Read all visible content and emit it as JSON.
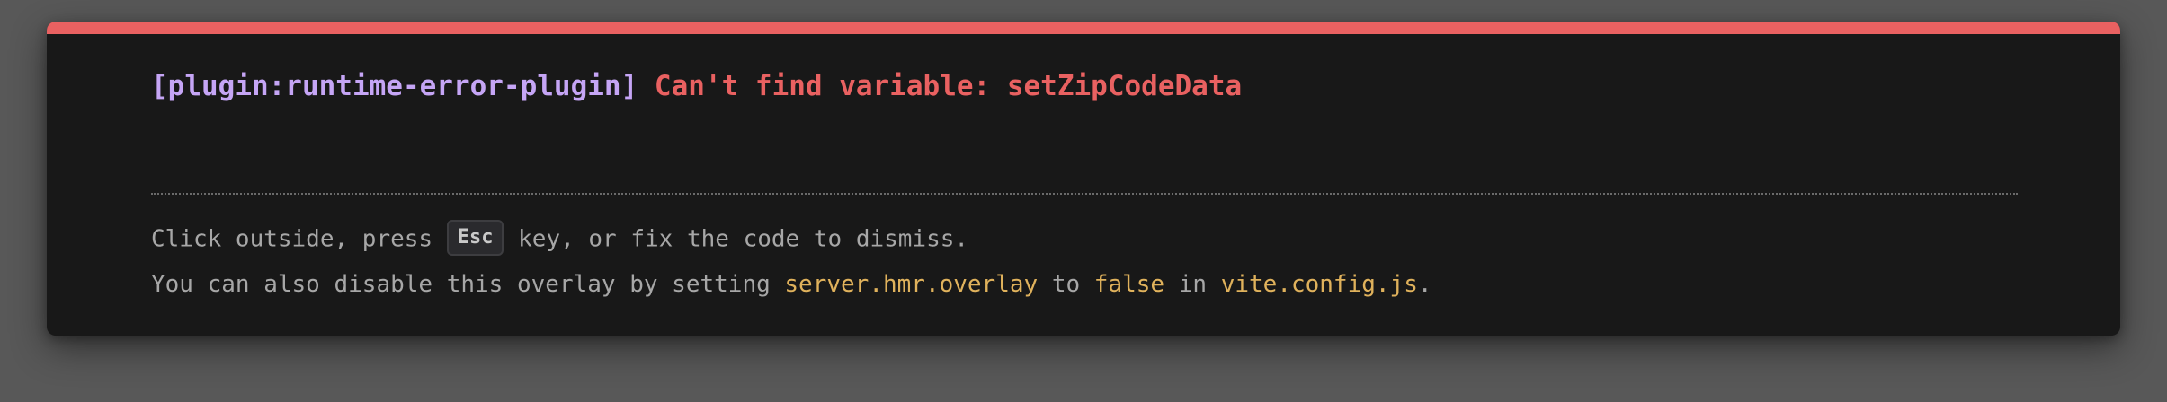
{
  "overlay": {
    "plugin_tag": "[plugin:runtime-error-plugin]",
    "error_message": "Can't find variable: setZipCodeData",
    "tip_line1": {
      "before": "Click outside, press",
      "key": "Esc",
      "after": "key, or fix the code to dismiss."
    },
    "tip_line2": {
      "part1": "You can also disable this overlay by setting",
      "setting": "server.hmr.overlay",
      "part2": "to",
      "value": "false",
      "part3": "in",
      "file": "vite.config.js",
      "end": "."
    }
  },
  "colors": {
    "accent_bar": "#e96161",
    "plugin_text": "#c5a5f5",
    "error_text": "#e96161",
    "code_highlight": "#e0b25c",
    "panel_bg": "#181818"
  }
}
